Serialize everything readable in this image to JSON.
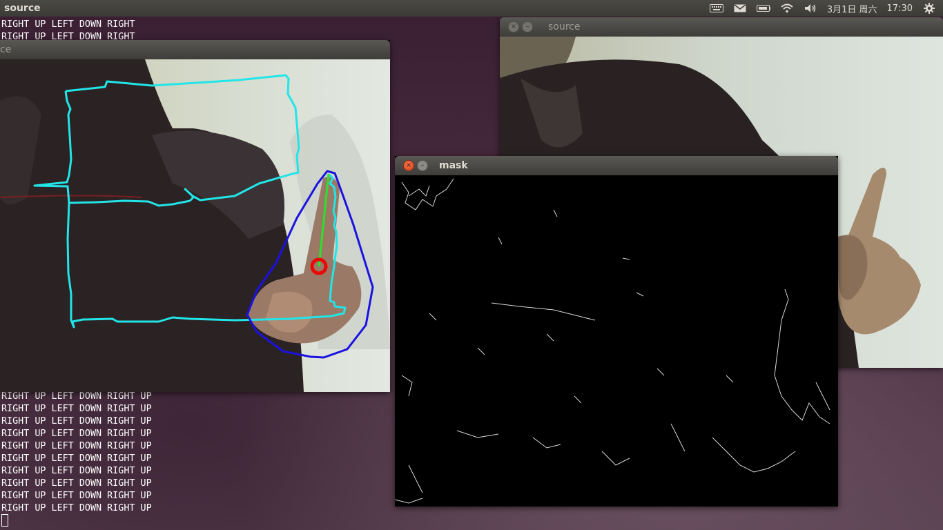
{
  "top_panel": {
    "app_title": "source",
    "date": "3月1日 周六",
    "time": "17:30",
    "tray_icons": [
      "keyboard-icon",
      "mail-icon",
      "battery-icon",
      "wifi-icon",
      "volume-icon",
      "gear-icon"
    ]
  },
  "terminal": {
    "top_lines": [
      "RIGHT UP LEFT DOWN RIGHT",
      "RIGHT UP LEFT DOWN RIGHT"
    ],
    "bottom_lines": [
      "RIGHT UP LEFT DOWN RIGHT UP",
      "RIGHT UP LEFT DOWN RIGHT UP",
      "RIGHT UP LEFT DOWN RIGHT UP",
      "RIGHT UP LEFT DOWN RIGHT UP",
      "RIGHT UP LEFT DOWN RIGHT UP",
      "RIGHT UP LEFT DOWN RIGHT UP",
      "RIGHT UP LEFT DOWN RIGHT UP",
      "RIGHT UP LEFT DOWN RIGHT UP",
      "RIGHT UP LEFT DOWN RIGHT UP",
      "RIGHT UP LEFT DOWN RIGHT UP"
    ]
  },
  "windows": {
    "source_left": {
      "title": "ce"
    },
    "source_right": {
      "title": "source"
    },
    "mask": {
      "title": "mask",
      "close_glyph": "×",
      "min_glyph": "–"
    }
  },
  "colors": {
    "trajectory": "#22e5e8",
    "hull": "#1a12e0",
    "fingertip_line": "#2ee02a",
    "center_marker": "#e80808"
  }
}
